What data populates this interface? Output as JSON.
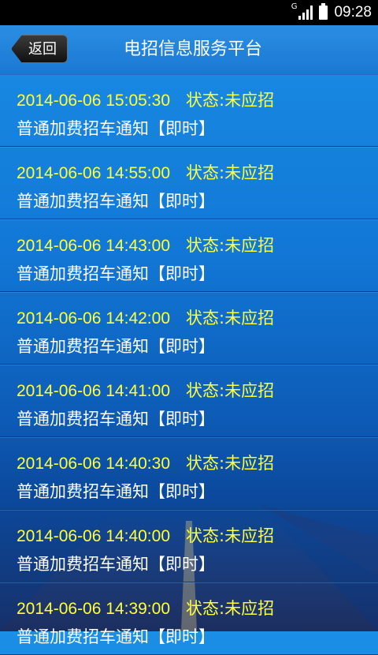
{
  "status_bar": {
    "network": "G",
    "time": "09:28"
  },
  "header": {
    "back_label": "返回",
    "title": "电招信息服务平台"
  },
  "notifications": [
    {
      "datetime": "2014-06-06 15:05:30",
      "status": "状态:未应招",
      "message": "普通加费招车通知【即时】"
    },
    {
      "datetime": "2014-06-06 14:55:00",
      "status": "状态:未应招",
      "message": "普通加费招车通知【即时】"
    },
    {
      "datetime": "2014-06-06 14:43:00",
      "status": "状态:未应招",
      "message": "普通加费招车通知【即时】"
    },
    {
      "datetime": "2014-06-06 14:42:00",
      "status": "状态:未应招",
      "message": "普通加费招车通知【即时】"
    },
    {
      "datetime": "2014-06-06 14:41:00",
      "status": "状态:未应招",
      "message": "普通加费招车通知【即时】"
    },
    {
      "datetime": "2014-06-06 14:40:30",
      "status": "状态:未应招",
      "message": "普通加费招车通知【即时】"
    },
    {
      "datetime": "2014-06-06 14:40:00",
      "status": "状态:未应招",
      "message": "普通加费招车通知【即时】"
    },
    {
      "datetime": "2014-06-06 14:39:00",
      "status": "状态:未应招",
      "message": "普通加费招车通知【即时】"
    }
  ],
  "colors": {
    "datetime_text": "#ffff3a",
    "message_text": "#ffffff",
    "header_bg": "#1b78d2"
  }
}
